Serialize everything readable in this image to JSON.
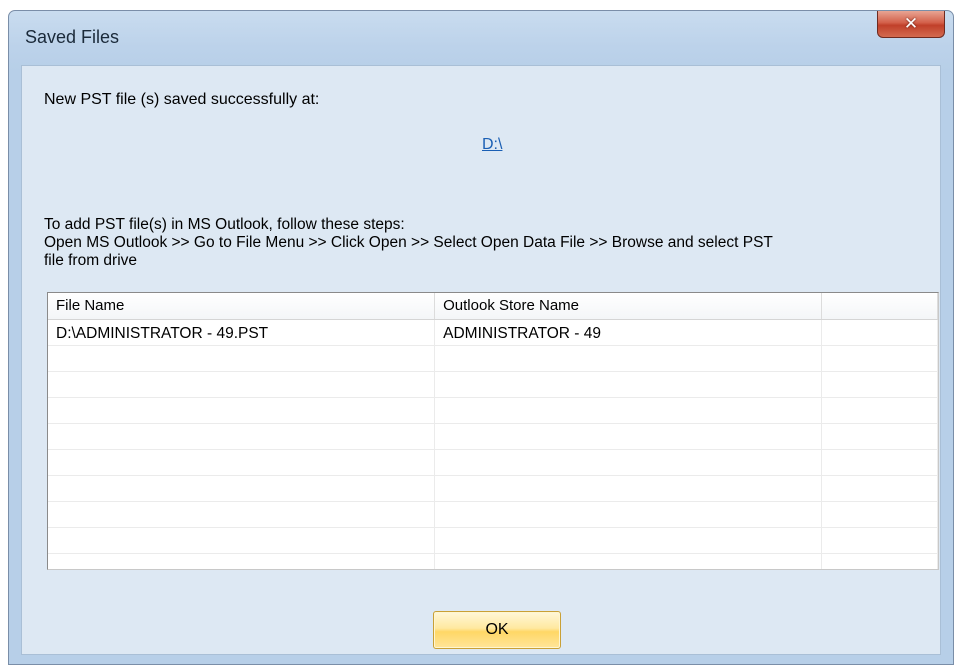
{
  "window": {
    "title": "Saved Files",
    "close_icon": "close-icon"
  },
  "message": {
    "saved_text": "New PST file (s) saved successfully at:",
    "path_link": "D:\\"
  },
  "instructions": {
    "line1": "To add PST file(s) in MS Outlook, follow these steps:",
    "line2": "Open MS Outlook  >> Go to File Menu >> Click Open >> Select Open Data File >>  Browse and select PST",
    "line3": "file from drive"
  },
  "grid": {
    "columns": [
      "File Name",
      "Outlook Store Name",
      ""
    ],
    "rows": [
      [
        "D:\\ADMINISTRATOR - 49.PST",
        "ADMINISTRATOR - 49",
        ""
      ],
      [
        "",
        "",
        ""
      ],
      [
        "",
        "",
        ""
      ],
      [
        "",
        "",
        ""
      ],
      [
        "",
        "",
        ""
      ],
      [
        "",
        "",
        ""
      ],
      [
        "",
        "",
        ""
      ],
      [
        "",
        "",
        ""
      ],
      [
        "",
        "",
        ""
      ],
      [
        "",
        "",
        ""
      ]
    ]
  },
  "buttons": {
    "ok_label": "OK"
  },
  "colors": {
    "link": "#1a5fb4",
    "close_button": "#c9482f",
    "ok_button": "#ffd766"
  }
}
